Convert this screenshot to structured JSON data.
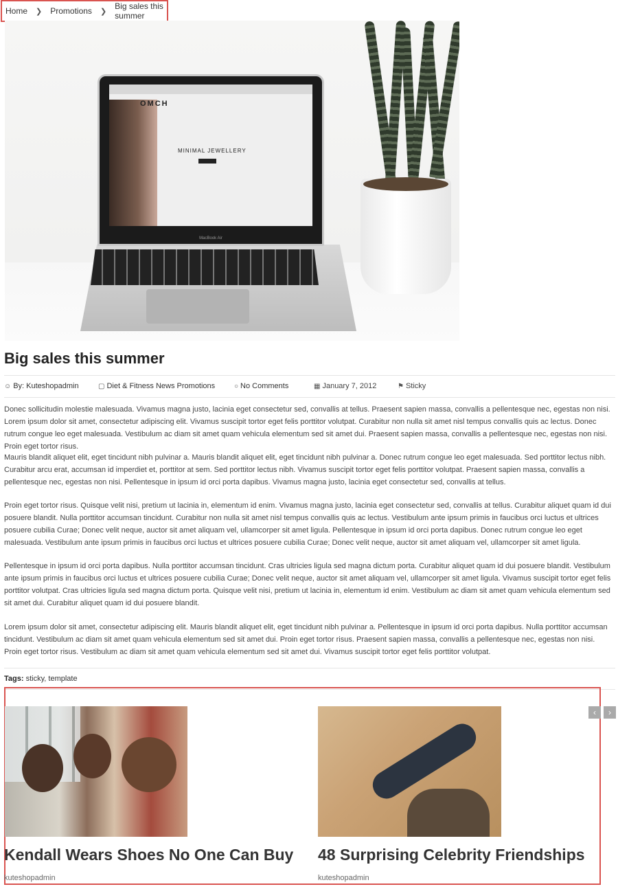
{
  "breadcrumb": {
    "items": [
      "Home",
      "Promotions",
      "Big sales this summer"
    ]
  },
  "post": {
    "title": "Big sales this summer",
    "hero_image_text": {
      "logo": "OMCH",
      "headline": "MINIMAL JEWELLERY",
      "device": "MacBook Air"
    },
    "meta": {
      "author": "By: Kuteshopadmin",
      "categories": "Diet & Fitness News Promotions",
      "comments": "No Comments",
      "date": "January 7, 2012",
      "sticky": "Sticky"
    },
    "paragraphs": [
      "Donec sollicitudin molestie malesuada. Vivamus magna justo, lacinia eget consectetur sed, convallis at tellus. Praesent sapien massa, convallis a pellentesque nec, egestas non nisi. Lorem ipsum dolor sit amet, consectetur adipiscing elit. Vivamus suscipit tortor eget felis porttitor volutpat. Curabitur non nulla sit amet nisl tempus convallis quis ac lectus. Donec rutrum congue leo eget malesuada. Vestibulum ac diam sit amet quam vehicula elementum sed sit amet dui. Praesent sapien massa, convallis a pellentesque nec, egestas non nisi. Proin eget tortor risus.",
      "Mauris blandit aliquet elit, eget tincidunt nibh pulvinar a. Mauris blandit aliquet elit, eget tincidunt nibh pulvinar a. Donec rutrum congue leo eget malesuada. Sed porttitor lectus nibh. Curabitur arcu erat, accumsan id imperdiet et, porttitor at sem. Sed porttitor lectus nibh. Vivamus suscipit tortor eget felis porttitor volutpat. Praesent sapien massa, convallis a pellentesque nec, egestas non nisi. Pellentesque in ipsum id orci porta dapibus. Vivamus magna justo, lacinia eget consectetur sed, convallis at tellus.",
      "Proin eget tortor risus. Quisque velit nisi, pretium ut lacinia in, elementum id enim. Vivamus magna justo, lacinia eget consectetur sed, convallis at tellus. Curabitur aliquet quam id dui posuere blandit. Nulla porttitor accumsan tincidunt. Curabitur non nulla sit amet nisl tempus convallis quis ac lectus. Vestibulum ante ipsum primis in faucibus orci luctus et ultrices posuere cubilia Curae; Donec velit neque, auctor sit amet aliquam vel, ullamcorper sit amet ligula. Pellentesque in ipsum id orci porta dapibus. Donec rutrum congue leo eget malesuada. Vestibulum ante ipsum primis in faucibus orci luctus et ultrices posuere cubilia Curae; Donec velit neque, auctor sit amet aliquam vel, ullamcorper sit amet ligula.",
      "Pellentesque in ipsum id orci porta dapibus. Nulla porttitor accumsan tincidunt. Cras ultricies ligula sed magna dictum porta. Curabitur aliquet quam id dui posuere blandit. Vestibulum ante ipsum primis in faucibus orci luctus et ultrices posuere cubilia Curae; Donec velit neque, auctor sit amet aliquam vel, ullamcorper sit amet ligula. Vivamus suscipit tortor eget felis porttitor volutpat. Cras ultricies ligula sed magna dictum porta. Quisque velit nisi, pretium ut lacinia in, elementum id enim. Vestibulum ac diam sit amet quam vehicula elementum sed sit amet dui. Curabitur aliquet quam id dui posuere blandit.",
      "Lorem ipsum dolor sit amet, consectetur adipiscing elit. Mauris blandit aliquet elit, eget tincidunt nibh pulvinar a. Pellentesque in ipsum id orci porta dapibus. Nulla porttitor accumsan tincidunt. Vestibulum ac diam sit amet quam vehicula elementum sed sit amet dui. Proin eget tortor risus. Praesent sapien massa, convallis a pellentesque nec, egestas non nisi. Proin eget tortor risus. Vestibulum ac diam sit amet quam vehicula elementum sed sit amet dui. Vivamus suscipit tortor eget felis porttitor volutpat."
    ],
    "tags_label": "Tags:",
    "tags": [
      "sticky",
      "template"
    ],
    "tag_separator": ","
  },
  "related": {
    "prev_icon": "‹",
    "next_icon": "›",
    "cards": [
      {
        "title": "Kendall Wears Shoes No One Can Buy",
        "author": "kuteshopadmin"
      },
      {
        "title": "48 Surprising Celebrity Friendships",
        "author": "kuteshopadmin"
      }
    ]
  },
  "colors": {
    "highlight_border": "#d9534f",
    "nav_button": "#aaaaaa"
  }
}
